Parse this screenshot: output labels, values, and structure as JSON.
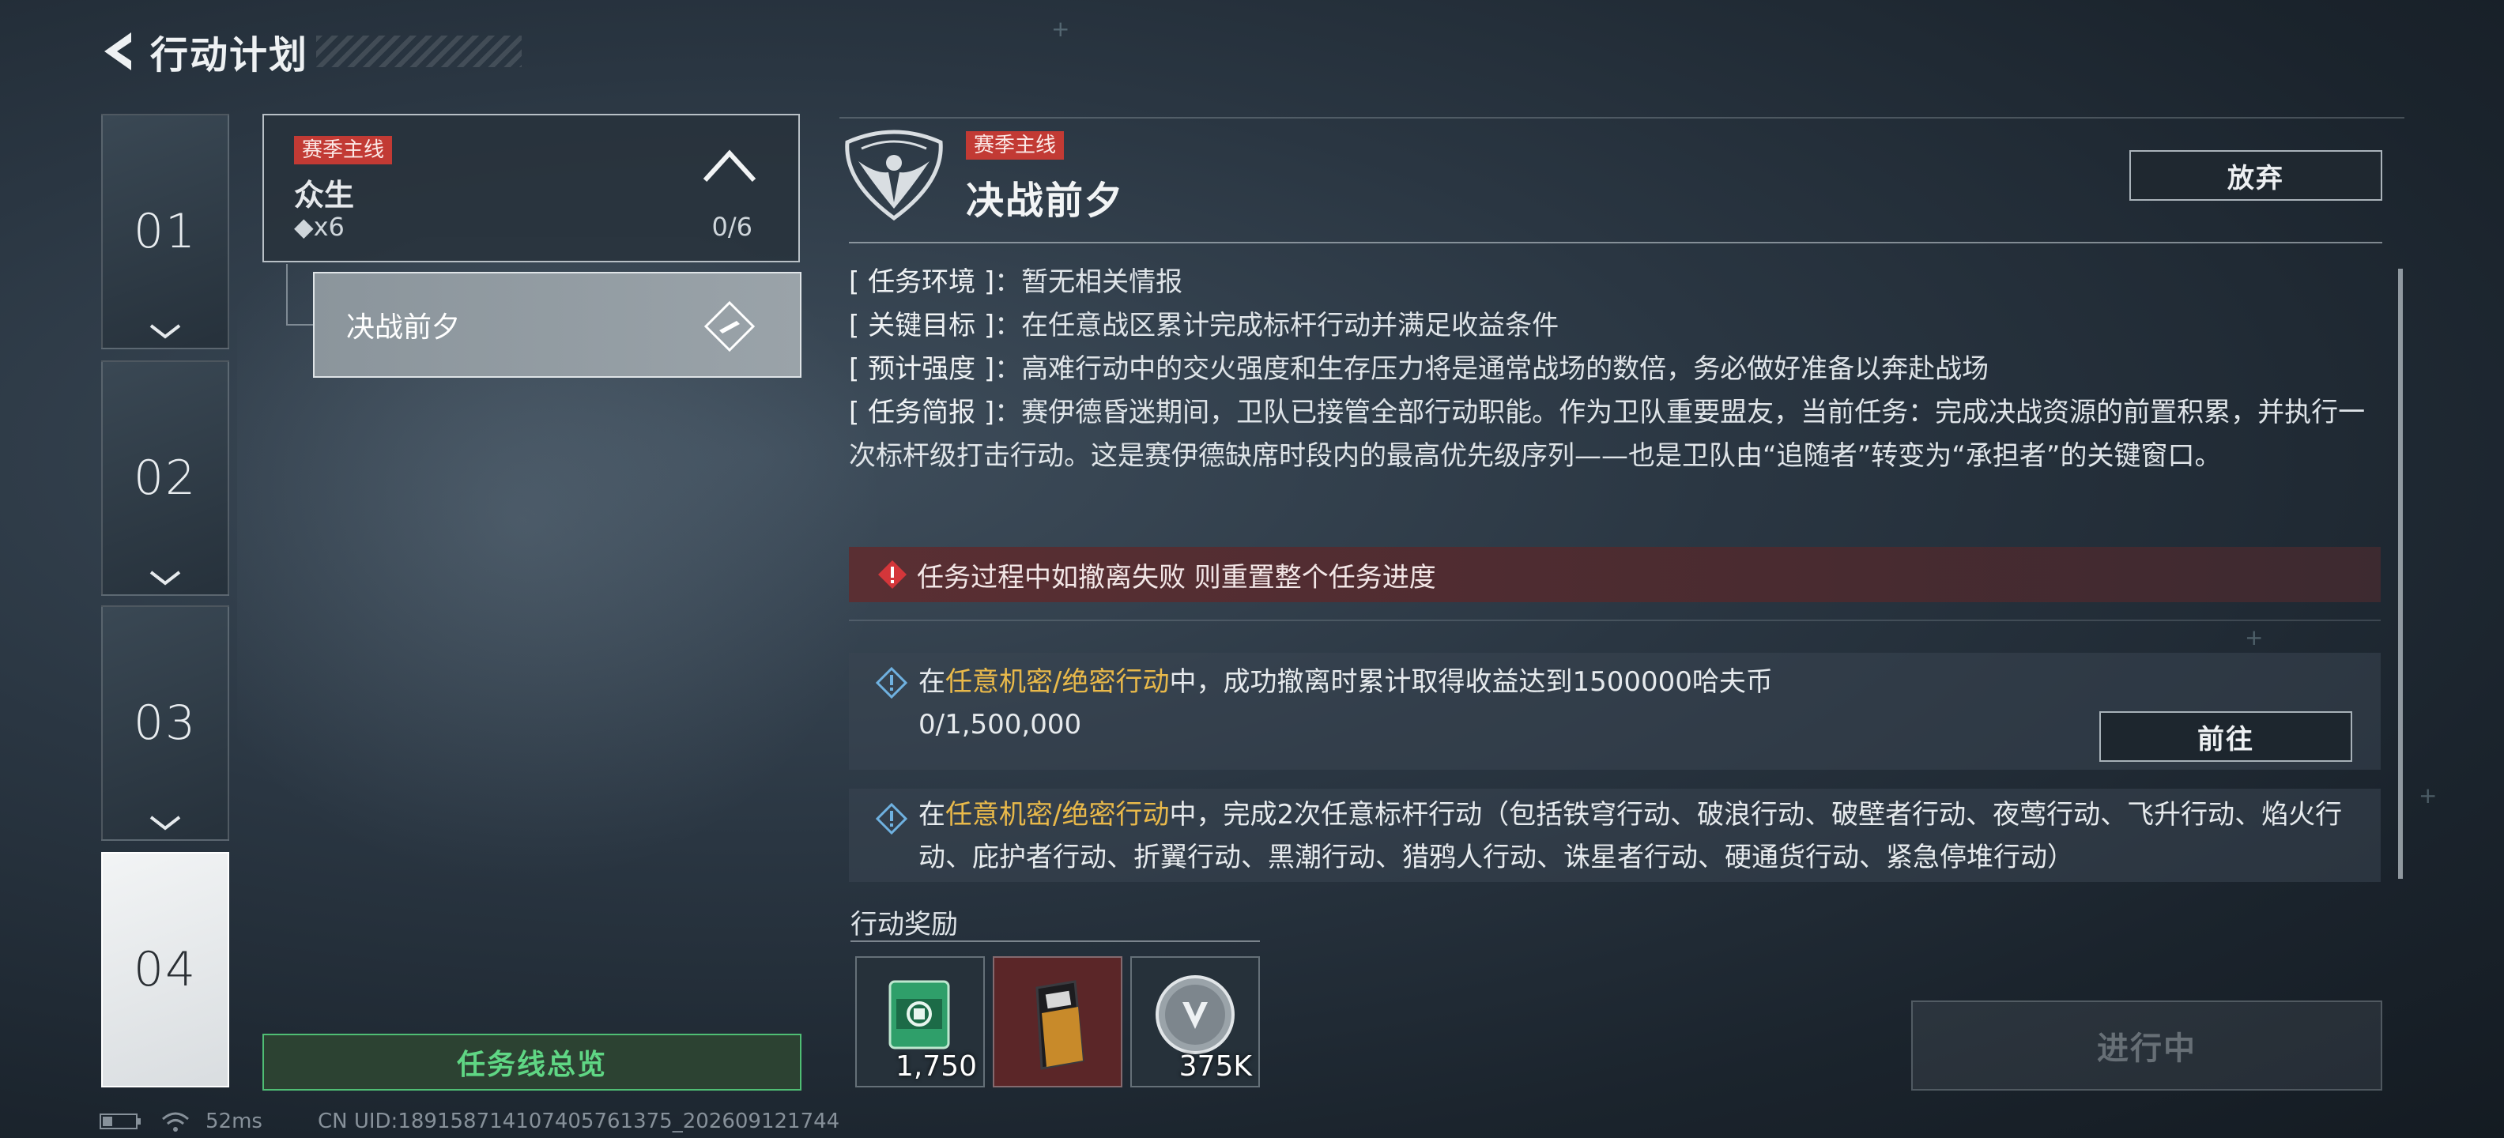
{
  "header": {
    "title": "行动计划"
  },
  "chapters": [
    {
      "label": "01"
    },
    {
      "label": "02"
    },
    {
      "label": "03"
    },
    {
      "label": "04"
    }
  ],
  "mission_list": {
    "card": {
      "tag": "赛季主线",
      "name": "众生",
      "reward": "◆x6",
      "progress": "0/6"
    },
    "sub_mission": {
      "name": "决战前夕"
    },
    "overview_button": "任务线总览"
  },
  "status_bar": {
    "ping": "52ms",
    "uid": "CN UID:189158714107405761375_202609121744"
  },
  "detail": {
    "tag": "赛季主线",
    "title": "决战前夕",
    "abandon_button": "放弃",
    "info": [
      {
        "label": "[ 任务环境 ]",
        "value": "：暂无相关情报"
      },
      {
        "label": "[ 关键目标 ]",
        "value": "：在任意战区累计完成标杆行动并满足收益条件"
      },
      {
        "label": "[ 预计强度 ]",
        "value": "：高难行动中的交火强度和生存压力将是通常战场的数倍，务必做好准备以奔赴战场"
      },
      {
        "label": "[ 任务简报 ]",
        "value": "：赛伊德昏迷期间，卫队已接管全部行动职能。作为卫队重要盟友，当前任务：完成决战资源的前置积累，并执行一次标杆级打击行动。这是赛伊德缺席时段内的最高优先级序列——也是卫队由“追随者”转变为“承担者”的关键窗口。"
      }
    ],
    "warning": "任务过程中如撤离失败 则重置整个任务进度",
    "objectives": [
      {
        "prefix": "在",
        "highlight": "任意机密/绝密行动",
        "suffix": "中，成功撤离时累计取得收益达到1500000哈夫币",
        "progress": "0/1,500,000",
        "button": "前往"
      },
      {
        "prefix": "在",
        "highlight": "任意机密/绝密行动",
        "suffix": "中，完成2次任意标杆行动（包括铁穹行动、破浪行动、破壁者行动、夜莺行动、飞升行动、焰火行动、庇护者行动、折翼行动、黑潮行动、猎鸦人行动、诛星者行动、硬通货行动、紧急停堆行动）"
      }
    ],
    "rewards_title": "行动奖励",
    "rewards": [
      {
        "icon": "green-crate-icon",
        "qty": "1,750"
      },
      {
        "icon": "supply-bag-icon",
        "qty": ""
      },
      {
        "icon": "silver-coin-icon",
        "qty": "375K"
      }
    ],
    "status_button": "进行中"
  },
  "colors": {
    "tag": "#c23a34",
    "highlight": "#e9b94a",
    "overview_green": "#5fd684",
    "warning_bg": "#5a2f33"
  }
}
